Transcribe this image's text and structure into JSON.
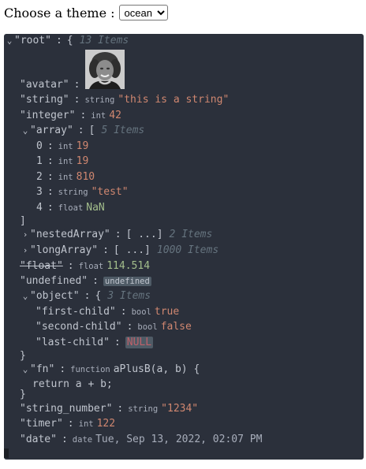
{
  "theme": {
    "label": "Choose a theme :",
    "selected": "ocean"
  },
  "root": {
    "key": "\"root\"",
    "brace": "{",
    "count": "13 Items",
    "avatar_key": "\"avatar\"",
    "string_key": "\"string\"",
    "string_type": "string",
    "string_value": "\"this is a string\"",
    "integer_key": "\"integer\"",
    "integer_type": "int",
    "integer_value": "42",
    "array": {
      "key": "\"array\"",
      "brace": "[",
      "count": "5 Items",
      "close": "]",
      "items": [
        {
          "index": "0",
          "type": "int",
          "value": "19"
        },
        {
          "index": "1",
          "type": "int",
          "value": "19"
        },
        {
          "index": "2",
          "type": "int",
          "value": "810"
        },
        {
          "index": "3",
          "type": "string",
          "value": "\"test\""
        },
        {
          "index": "4",
          "type": "float",
          "value": "NaN"
        }
      ]
    },
    "nestedArray": {
      "key": "\"nestedArray\"",
      "collapsed": "[ ...]",
      "count": "2 Items"
    },
    "longArray": {
      "key": "\"longArray\"",
      "collapsed": "[ ...]",
      "count": "1000 Items"
    },
    "float_key": "\"float\"",
    "float_type": "float",
    "float_value": "114.514",
    "undefined_key": "\"undefined\"",
    "undefined_value": "undefined",
    "object": {
      "key": "\"object\"",
      "brace": "{",
      "count": "3 Items",
      "close": "}",
      "first_key": "\"first-child\"",
      "first_type": "bool",
      "first_value": "true",
      "second_key": "\"second-child\"",
      "second_type": "bool",
      "second_value": "false",
      "last_key": "\"last-child\"",
      "last_value": "NULL"
    },
    "fn": {
      "key": "\"fn\"",
      "type": "function",
      "signature": "aPlusB(a, b) {",
      "body": "return a + b;",
      "close": "}"
    },
    "string_number_key": "\"string_number\"",
    "string_number_type": "string",
    "string_number_value": "\"1234\"",
    "timer_key": "\"timer\"",
    "timer_type": "int",
    "timer_value": "122",
    "date_key": "\"date\"",
    "date_type": "date",
    "date_value": "Tue, Sep 13, 2022, 02:07 PM"
  },
  "colors": {
    "background": "#2b303b",
    "string": "#d08770",
    "float": "#a3be8c",
    "null": "#bf616a"
  },
  "icons": {
    "expand": "chevron-down-icon",
    "collapse": "chevron-right-icon"
  }
}
